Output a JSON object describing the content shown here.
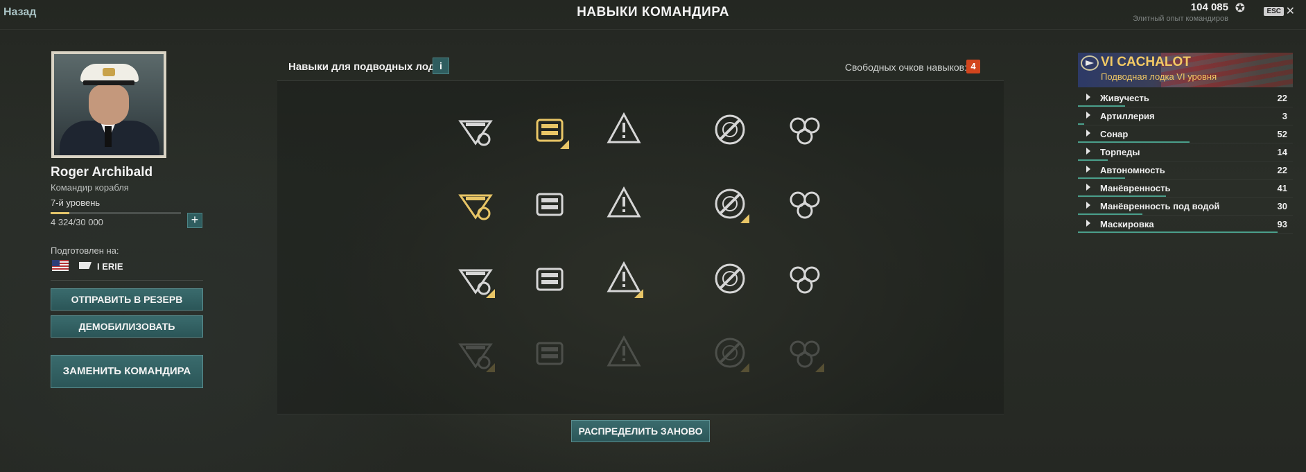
{
  "header": {
    "back_label": "Назад",
    "title": "НАВЫКИ КОМАНДИРА",
    "elite_xp_value": "104 085",
    "elite_xp_label": "Элитный опыт командиров",
    "esc_label": "ESC",
    "close_glyph": "✕"
  },
  "commander": {
    "name": "Roger Archibald",
    "role": "Командир корабля",
    "level": "7-й уровень",
    "level_progress": 0.144,
    "xp_text": "4 324/30 000",
    "plus_label": "+",
    "trained_label": "Подготовлен на:",
    "ship_name": "I ERIE"
  },
  "actions": {
    "reserve": "ОТПРАВИТЬ В РЕЗЕРВ",
    "demobilize": "ДЕМОБИЛИЗОВАТЬ",
    "replace": "ЗАМЕНИТЬ КОМАНДИРА",
    "redistribute": "РАСПРЕДЕЛИТЬ ЗАНОВО"
  },
  "skills_panel": {
    "title": "Навыки для подводных лодок",
    "info_label": "i",
    "free_points_label": "Свободных очков навыков:",
    "free_points": "4",
    "skills": [
      {
        "icon": "sonar-reload-icon",
        "state": "normal",
        "upgraded": false
      },
      {
        "icon": "torpedo-tubes-icon",
        "state": "gold",
        "upgraded": true
      },
      {
        "icon": "torpedo-reload-icon",
        "state": "normal",
        "upgraded": false
      },
      {
        "icon": "warning-target-icon",
        "state": "normal",
        "upgraded": false
      },
      {
        "icon": "shell-warning-icon",
        "state": "normal",
        "upgraded": false
      },
      {
        "icon": "battery-icon",
        "state": "gold",
        "upgraded": false
      },
      {
        "icon": "sonar-ping-icon",
        "state": "normal",
        "upgraded": false
      },
      {
        "icon": "diving-plane-icon",
        "state": "normal",
        "upgraded": false
      },
      {
        "icon": "electric-hazard-icon",
        "state": "normal",
        "upgraded": true
      },
      {
        "icon": "propeller-wheel-icon",
        "state": "normal",
        "upgraded": false
      },
      {
        "icon": "sonar-timer-icon",
        "state": "normal",
        "upgraded": true
      },
      {
        "icon": "submarine-detect-icon",
        "state": "normal",
        "upgraded": false
      },
      {
        "icon": "torpedo-timer-icon",
        "state": "normal",
        "upgraded": true
      },
      {
        "icon": "alert-circle-icon",
        "state": "normal",
        "upgraded": false
      },
      {
        "icon": "torpedo-rack-icon",
        "state": "normal",
        "upgraded": false
      },
      {
        "icon": "crossed-torpedoes-icon",
        "state": "locked",
        "upgraded": true
      },
      {
        "icon": "sonar-burn-icon",
        "state": "locked",
        "upgraded": false
      },
      {
        "icon": "submarine-fire-icon",
        "state": "locked",
        "upgraded": false
      },
      {
        "icon": "battery-upgrade-icon",
        "state": "locked",
        "upgraded": true
      },
      {
        "icon": "propeller-icon",
        "state": "locked",
        "upgraded": true
      }
    ]
  },
  "ship": {
    "name": "VI CACHALOT",
    "subtitle": "Подводная лодка VI уровня",
    "params": [
      {
        "label": "Живучесть",
        "value": "22"
      },
      {
        "label": "Артиллерия",
        "value": "3"
      },
      {
        "label": "Сонар",
        "value": "52"
      },
      {
        "label": "Торпеды",
        "value": "14"
      },
      {
        "label": "Автономность",
        "value": "22"
      },
      {
        "label": "Манёвренность",
        "value": "41"
      },
      {
        "label": "Манёвренность под водой",
        "value": "30"
      },
      {
        "label": "Маскировка",
        "value": "93"
      }
    ]
  },
  "colors": {
    "accent_teal": "#2f5d5f",
    "gold": "#e8c566",
    "badge_orange": "#d2451d",
    "ship_title": "#f2c964"
  }
}
